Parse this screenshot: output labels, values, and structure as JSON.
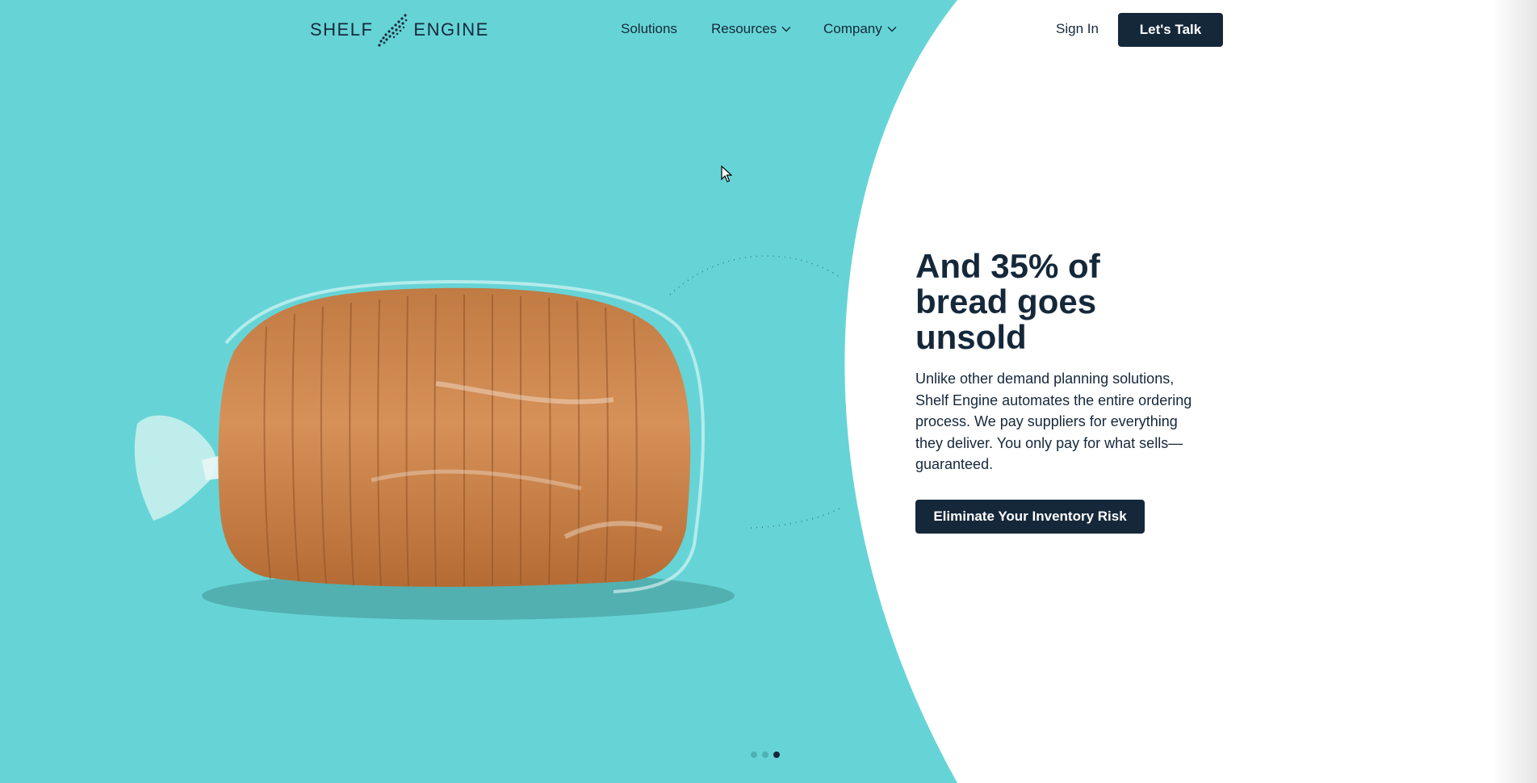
{
  "brand": {
    "left": "SHELF",
    "right": "ENGINE"
  },
  "nav": {
    "solutions": "Solutions",
    "resources": "Resources",
    "company": "Company"
  },
  "header": {
    "sign_in": "Sign In",
    "cta": "Let's Talk"
  },
  "hero": {
    "headline": "And 35% of bread goes unsold",
    "body": "Unlike other demand planning solutions, Shelf Engine automates the entire ordering process. We pay suppliers for everything they deliver. You only pay for what sells—guaranteed.",
    "cta": "Eliminate Your Inventory Risk"
  },
  "carousel": {
    "slides": 3,
    "active": 3
  },
  "colors": {
    "teal": "#66d4d6",
    "navy": "#15283a",
    "white": "#ffffff"
  }
}
